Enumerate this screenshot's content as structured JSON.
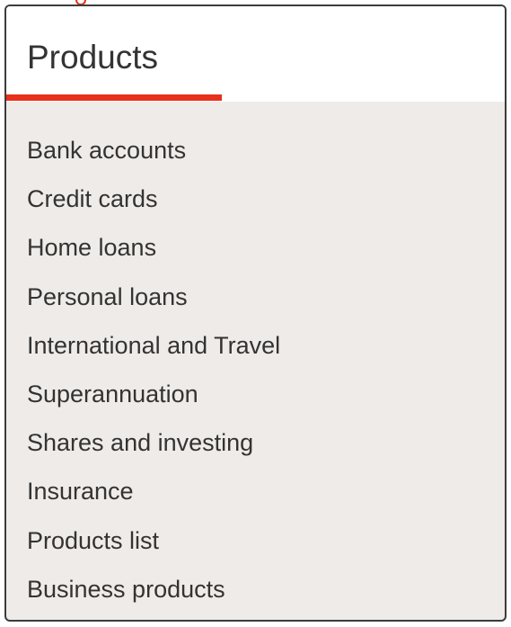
{
  "panel": {
    "title": "Products",
    "accent_color": "#e8301c",
    "items": [
      {
        "label": "Bank accounts"
      },
      {
        "label": "Credit cards"
      },
      {
        "label": "Home loans"
      },
      {
        "label": "Personal loans"
      },
      {
        "label": "International and Travel"
      },
      {
        "label": "Superannuation"
      },
      {
        "label": "Shares and investing"
      },
      {
        "label": "Insurance"
      },
      {
        "label": "Products list"
      },
      {
        "label": "Business products"
      }
    ]
  }
}
